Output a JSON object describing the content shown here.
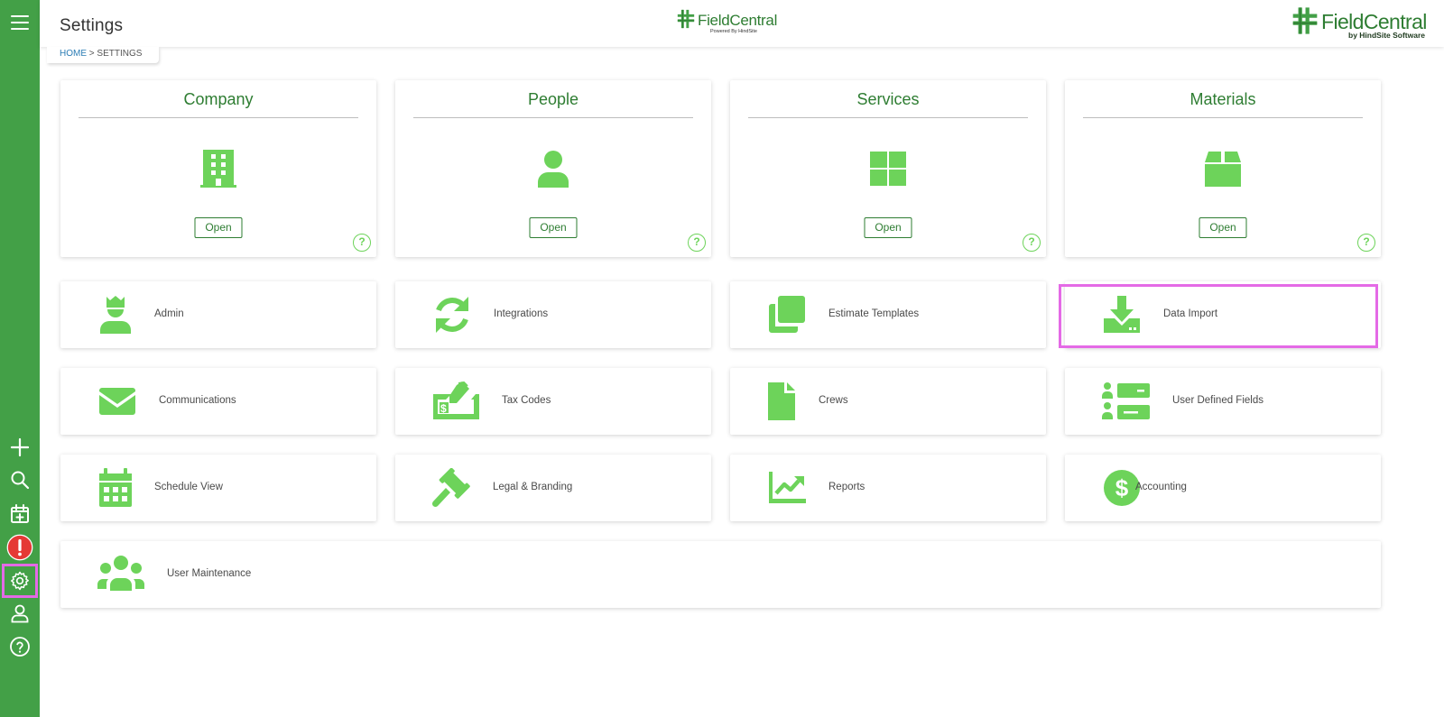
{
  "header": {
    "title": "Settings",
    "center_logo": {
      "name": "FieldCentral",
      "sub": "Powered By HindSite"
    },
    "right_logo": {
      "name": "FieldCentral",
      "sub": "by HindSite Software"
    }
  },
  "breadcrumb": {
    "home": "HOME",
    "separator": " > ",
    "current": "SETTINGS"
  },
  "sidebar": {
    "items": [
      {
        "icon": "menu-icon"
      },
      {
        "icon": "plus-icon"
      },
      {
        "icon": "search-icon"
      },
      {
        "icon": "calendar-add-icon"
      },
      {
        "icon": "alert-icon"
      },
      {
        "icon": "gear-icon",
        "active": true
      },
      {
        "icon": "user-icon"
      },
      {
        "icon": "help-icon"
      }
    ]
  },
  "big_cards": [
    {
      "title": "Company",
      "icon": "building-icon",
      "button": "Open",
      "help": "?"
    },
    {
      "title": "People",
      "icon": "person-icon",
      "button": "Open",
      "help": "?"
    },
    {
      "title": "Services",
      "icon": "grid-icon",
      "button": "Open",
      "help": "?"
    },
    {
      "title": "Materials",
      "icon": "box-icon",
      "button": "Open",
      "help": "?"
    }
  ],
  "tiles": [
    {
      "label": "Admin",
      "icon": "admin-icon"
    },
    {
      "label": "Integrations",
      "icon": "sync-icon"
    },
    {
      "label": "Estimate Templates",
      "icon": "copy-icon"
    },
    {
      "label": "Data Import",
      "icon": "download-icon",
      "highlighted": true
    },
    {
      "label": "Communications",
      "icon": "envelope-icon"
    },
    {
      "label": "Tax Codes",
      "icon": "tax-check-icon"
    },
    {
      "label": "Crews",
      "icon": "file-icon"
    },
    {
      "label": "User Defined Fields",
      "icon": "user-fields-icon"
    },
    {
      "label": "Schedule View",
      "icon": "calendar-icon"
    },
    {
      "label": "Legal & Branding",
      "icon": "gavel-icon"
    },
    {
      "label": "Reports",
      "icon": "chart-line-icon"
    },
    {
      "label": "Accounting",
      "icon": "dollar-icon"
    },
    {
      "label": "User Maintenance",
      "icon": "users-icon"
    }
  ],
  "colors": {
    "sidebar": "#43a047",
    "icon_green": "#6dd35a",
    "title_green": "#2e7d32",
    "highlight": "#e46ae6",
    "alert_red": "#e53935"
  }
}
